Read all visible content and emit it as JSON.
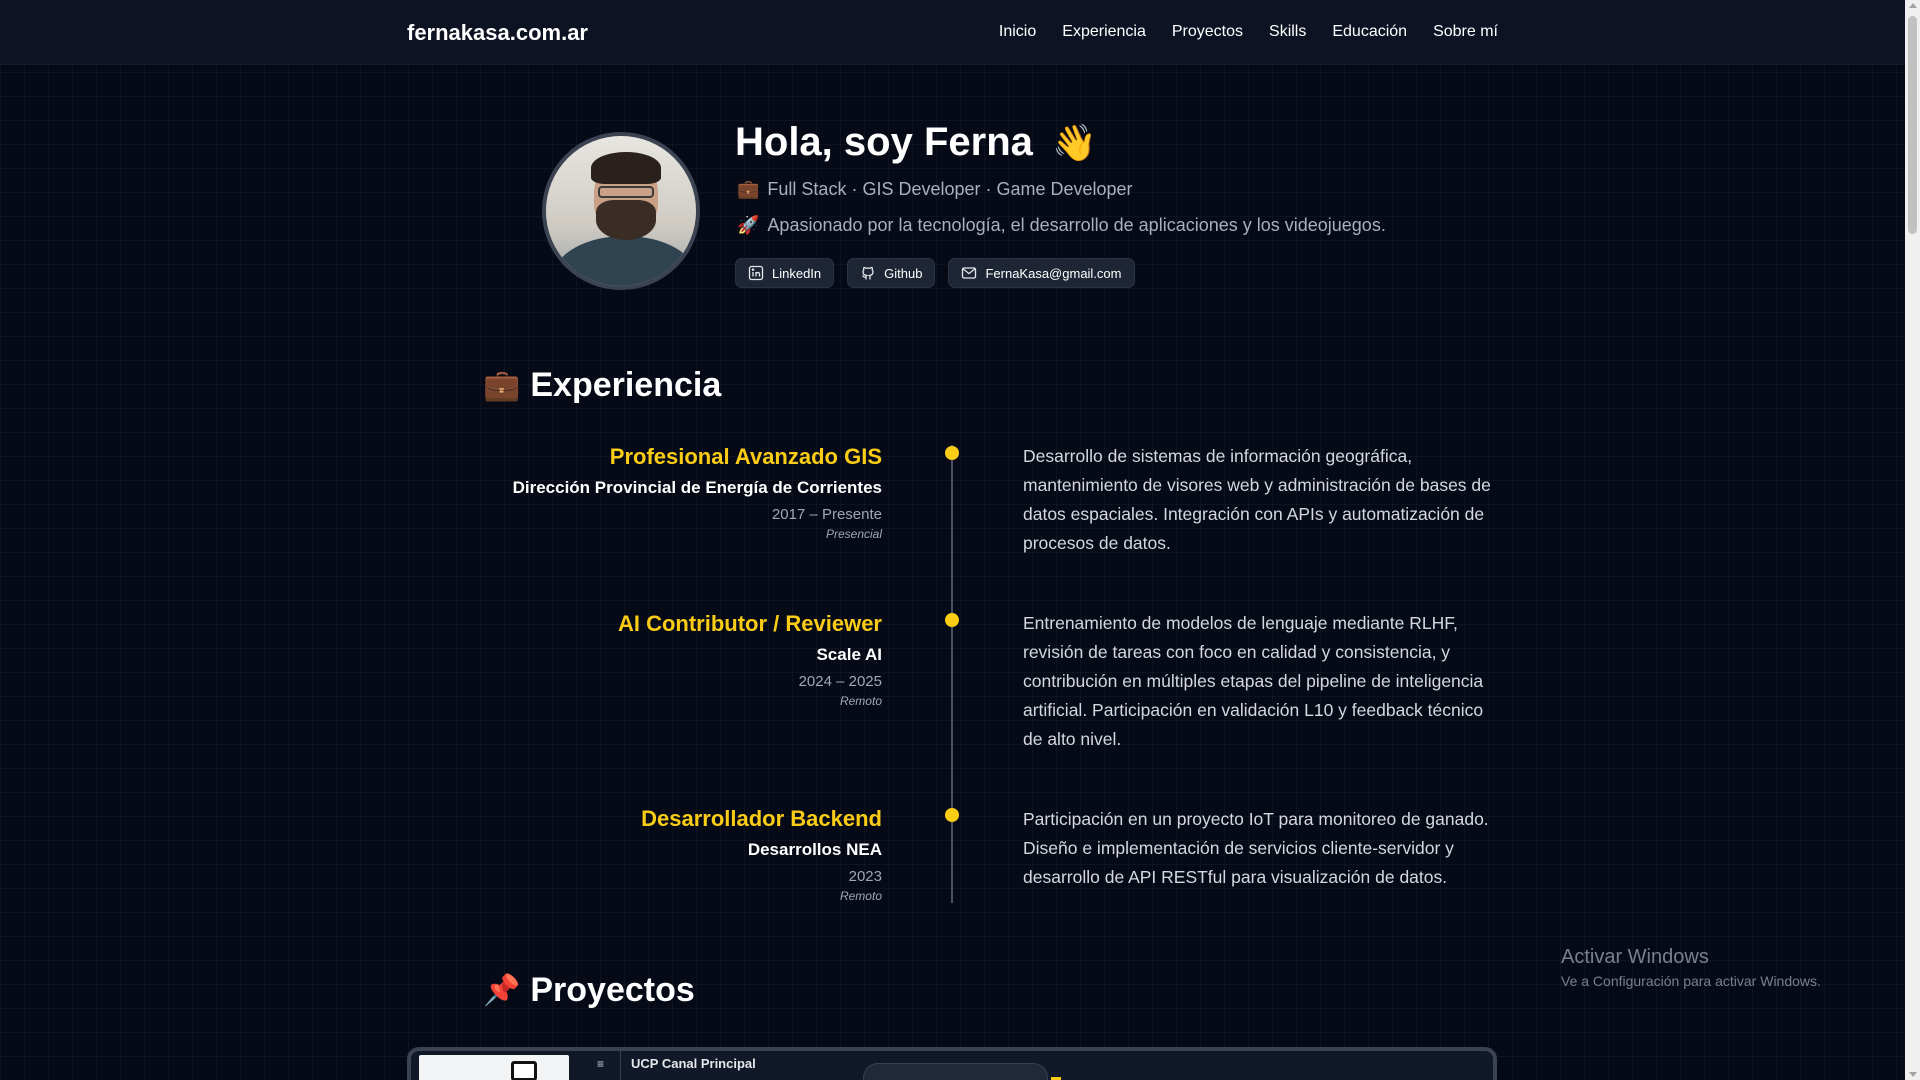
{
  "nav": {
    "brand": "fernakasa.com.ar",
    "links": [
      "Inicio",
      "Experiencia",
      "Proyectos",
      "Skills",
      "Educación",
      "Sobre mí"
    ]
  },
  "hero": {
    "title": "Hola, soy Ferna",
    "wave_emoji": "👋",
    "subtitle_emoji": "💼",
    "subtitle": "Full Stack · GIS Developer · Game Developer",
    "desc_emoji": "🚀",
    "description": "Apasionado por la tecnología, el desarrollo de aplicaciones y los videojuegos.",
    "socials": {
      "linkedin": "LinkedIn",
      "github": "Github",
      "email": "FernaKasa@gmail.com"
    }
  },
  "experience": {
    "emoji": "💼",
    "title": "Experiencia",
    "jobs": [
      {
        "role": "Profesional Avanzado GIS",
        "company": "Dirección Provincial de Energía de Corrientes",
        "years": "2017 – Presente",
        "mode": "Presencial",
        "description": "Desarrollo de sistemas de información geográfica, mantenimiento de visores web y administración de bases de datos espaciales. Integración con APIs y automatización de procesos de datos."
      },
      {
        "role": "AI Contributor / Reviewer",
        "company": "Scale AI",
        "years": "2024 – 2025",
        "mode": "Remoto",
        "description": "Entrenamiento de modelos de lenguaje mediante RLHF, revisión de tareas con foco en calidad y consistencia, y contribución en múltiples etapas del pipeline de inteligencia artificial. Participación en validación L10 y feedback técnico de alto nivel."
      },
      {
        "role": "Desarrollador Backend",
        "company": "Desarrollos NEA",
        "years": "2023",
        "mode": "Remoto",
        "description": "Participación en un proyecto IoT para monitoreo de ganado. Diseño e implementación de servicios cliente-servidor y desarrollo de API RESTful para visualización de datos."
      }
    ]
  },
  "projects": {
    "emoji": "📌",
    "title": "Proyectos",
    "preview_caption": "UCP Canal Principal",
    "preview_menu_icon": "≡"
  },
  "watermark": {
    "title": "Activar Windows",
    "subtitle": "Ve a Configuración para activar Windows."
  },
  "colors": {
    "accent": "#facc15",
    "background": "#060a17",
    "nav": "#0d1322"
  }
}
